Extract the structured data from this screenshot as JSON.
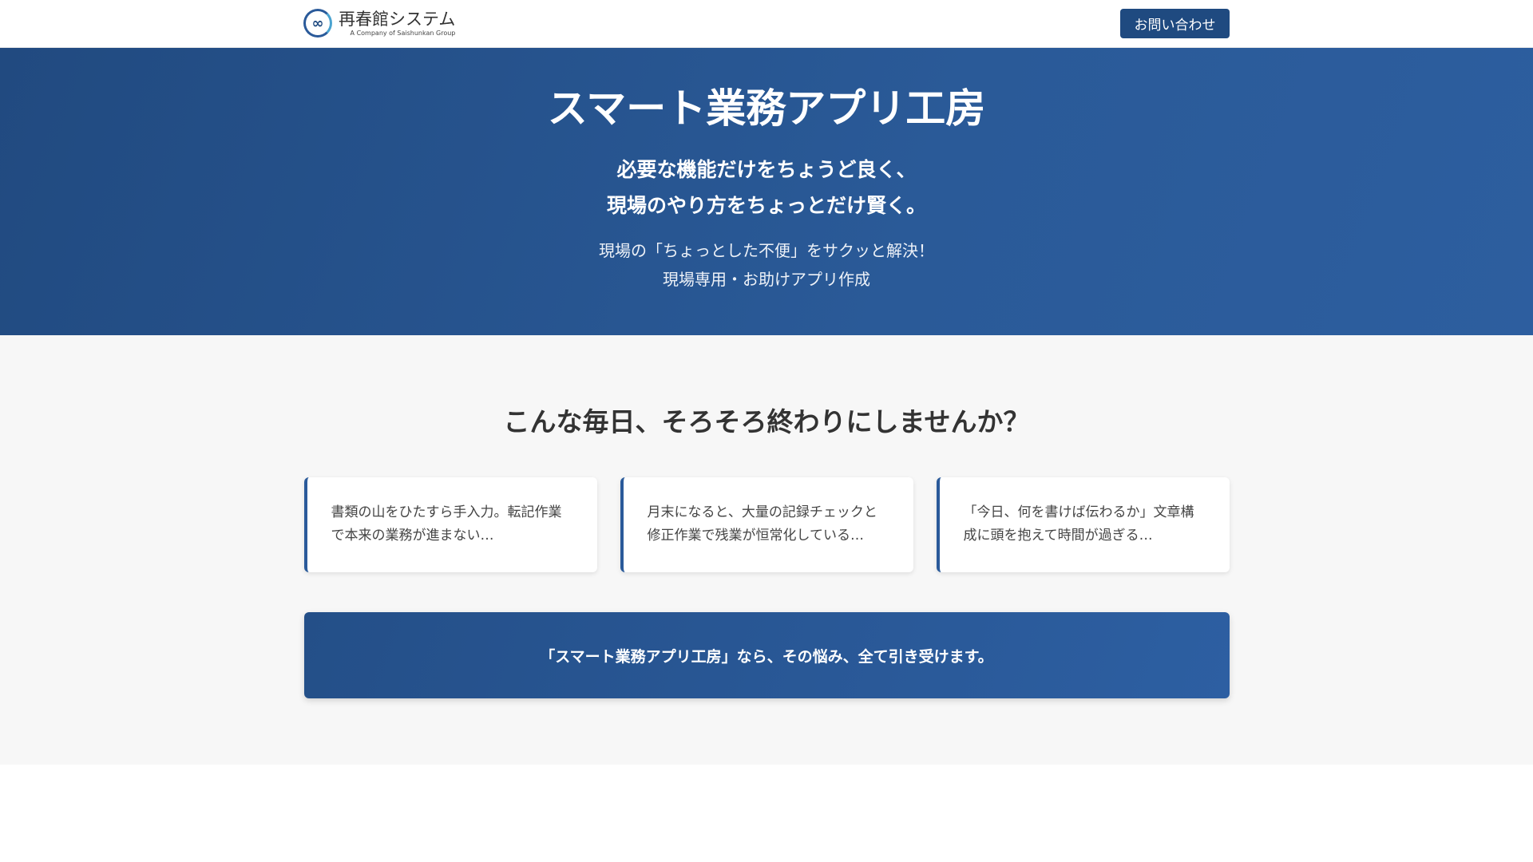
{
  "header": {
    "logo_name": "再春館システム",
    "logo_sub": "A Company of Saishunkan Group",
    "contact_label": "お問い合わせ"
  },
  "hero": {
    "title": "スマート業務アプリ工房",
    "tagline": [
      "必要な機能だけをちょうど良く、",
      "現場のやり方をちょっとだけ賢く。"
    ],
    "description": [
      "現場の「ちょっとした不便」をサクッと解決！",
      "現場専用・お助けアプリ作成"
    ]
  },
  "problems": {
    "heading": "こんな毎日、そろそろ終わりにしませんか？",
    "cards": [
      {
        "text": "書類の山をひたすら手入力。転記作業で本来の業務が進まない…"
      },
      {
        "text": "月末になると、大量の記録チェックと修正作業で残業が恒常化している…"
      },
      {
        "text": "「今日、何を書けば伝わるか」文章構成に頭を抱えて時間が過ぎる…"
      }
    ],
    "banner": "「スマート業務アプリ工房」なら、その悩み、全て引き受けます。"
  }
}
